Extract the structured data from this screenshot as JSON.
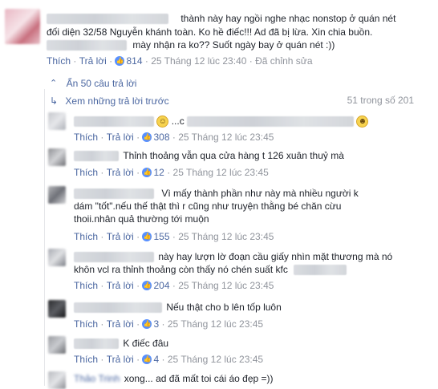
{
  "main_comment": {
    "line1": "thành này hay ngồi nghe nhạc nonstop ở quán nét",
    "line2": "đối diện 32/58 Nguyễn khánh toàn. Ko hề điếc!!! Ad đã bị lừa. Xin chia buồn.",
    "line3": "mày nhận ra ko?? Suốt ngày bay ở quán nét :))",
    "like_label": "Thích",
    "reply_label": "Trả lời",
    "like_count": "814",
    "timestamp": "25 Tháng 12 lúc 23:40",
    "edited_label": "Đã chỉnh sửa"
  },
  "thread": {
    "hide_replies_label": "Ẩn 50 câu trả lời",
    "view_previous_label": "Xem những trả lời trước",
    "count_label": "51 trong số 201"
  },
  "replies": [
    {
      "text_prefix": "...c",
      "like_count": "308",
      "timestamp": "25 Tháng 12 lúc 23:45"
    },
    {
      "text": "Thỉnh thoảng vẫn qua cửa hàng t 126 xuân thuỷ mà",
      "like_count": "12",
      "timestamp": "25 Tháng 12 lúc 23:45"
    },
    {
      "line1": "Vì mấy thành phần như này mà nhiều người k",
      "line2": "dám \"tốt\".nếu thế thật thì r cũng như truyện thằng bé chăn cừu",
      "line3": "thoii.nhân quả thường tới muộn",
      "like_count": "155",
      "timestamp": "25 Tháng 12 lúc 23:45"
    },
    {
      "line1": "này hay lượn lờ đoạn cầu giấy nhìn mặt thương mà nó",
      "line2": "khôn vcl ra thỉnh thoảng còn thấy nó chén suất kfc",
      "like_count": "204",
      "timestamp": "25 Tháng 12 lúc 23:45"
    },
    {
      "text": "Nếu thật cho b lên tốp luôn",
      "like_count": "3",
      "timestamp": "25 Tháng 12 lúc 23:45"
    },
    {
      "text": "K điếc đâu",
      "like_count": "4",
      "timestamp": "25 Tháng 12 lúc 23:45"
    },
    {
      "author": "Thảo Trinh",
      "text": "xong... ad đã mất toi cái áo đẹp =))"
    }
  ],
  "common": {
    "like_label": "Thích",
    "reply_label": "Trả lời",
    "sep": "·"
  }
}
